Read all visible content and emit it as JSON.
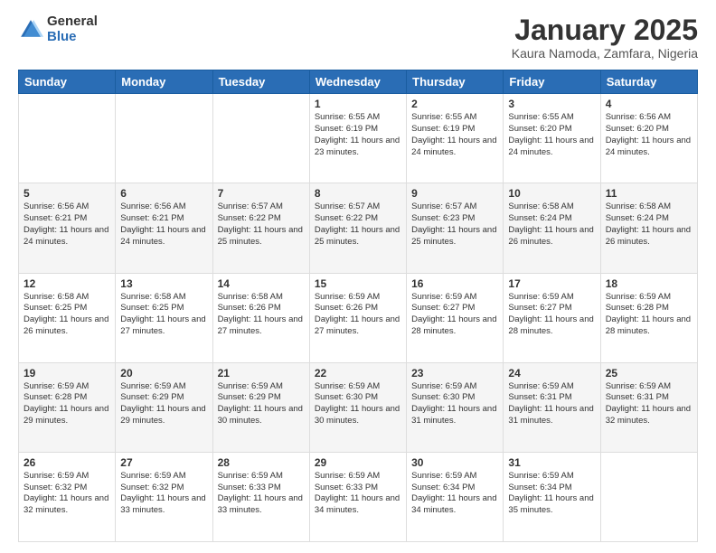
{
  "header": {
    "logo_general": "General",
    "logo_blue": "Blue",
    "month_title": "January 2025",
    "location": "Kaura Namoda, Zamfara, Nigeria"
  },
  "weekdays": [
    "Sunday",
    "Monday",
    "Tuesday",
    "Wednesday",
    "Thursday",
    "Friday",
    "Saturday"
  ],
  "weeks": [
    [
      {
        "day": "",
        "info": ""
      },
      {
        "day": "",
        "info": ""
      },
      {
        "day": "",
        "info": ""
      },
      {
        "day": "1",
        "info": "Sunrise: 6:55 AM\nSunset: 6:19 PM\nDaylight: 11 hours\nand 23 minutes."
      },
      {
        "day": "2",
        "info": "Sunrise: 6:55 AM\nSunset: 6:19 PM\nDaylight: 11 hours\nand 24 minutes."
      },
      {
        "day": "3",
        "info": "Sunrise: 6:55 AM\nSunset: 6:20 PM\nDaylight: 11 hours\nand 24 minutes."
      },
      {
        "day": "4",
        "info": "Sunrise: 6:56 AM\nSunset: 6:20 PM\nDaylight: 11 hours\nand 24 minutes."
      }
    ],
    [
      {
        "day": "5",
        "info": "Sunrise: 6:56 AM\nSunset: 6:21 PM\nDaylight: 11 hours\nand 24 minutes."
      },
      {
        "day": "6",
        "info": "Sunrise: 6:56 AM\nSunset: 6:21 PM\nDaylight: 11 hours\nand 24 minutes."
      },
      {
        "day": "7",
        "info": "Sunrise: 6:57 AM\nSunset: 6:22 PM\nDaylight: 11 hours\nand 25 minutes."
      },
      {
        "day": "8",
        "info": "Sunrise: 6:57 AM\nSunset: 6:22 PM\nDaylight: 11 hours\nand 25 minutes."
      },
      {
        "day": "9",
        "info": "Sunrise: 6:57 AM\nSunset: 6:23 PM\nDaylight: 11 hours\nand 25 minutes."
      },
      {
        "day": "10",
        "info": "Sunrise: 6:58 AM\nSunset: 6:24 PM\nDaylight: 11 hours\nand 26 minutes."
      },
      {
        "day": "11",
        "info": "Sunrise: 6:58 AM\nSunset: 6:24 PM\nDaylight: 11 hours\nand 26 minutes."
      }
    ],
    [
      {
        "day": "12",
        "info": "Sunrise: 6:58 AM\nSunset: 6:25 PM\nDaylight: 11 hours\nand 26 minutes."
      },
      {
        "day": "13",
        "info": "Sunrise: 6:58 AM\nSunset: 6:25 PM\nDaylight: 11 hours\nand 27 minutes."
      },
      {
        "day": "14",
        "info": "Sunrise: 6:58 AM\nSunset: 6:26 PM\nDaylight: 11 hours\nand 27 minutes."
      },
      {
        "day": "15",
        "info": "Sunrise: 6:59 AM\nSunset: 6:26 PM\nDaylight: 11 hours\nand 27 minutes."
      },
      {
        "day": "16",
        "info": "Sunrise: 6:59 AM\nSunset: 6:27 PM\nDaylight: 11 hours\nand 28 minutes."
      },
      {
        "day": "17",
        "info": "Sunrise: 6:59 AM\nSunset: 6:27 PM\nDaylight: 11 hours\nand 28 minutes."
      },
      {
        "day": "18",
        "info": "Sunrise: 6:59 AM\nSunset: 6:28 PM\nDaylight: 11 hours\nand 28 minutes."
      }
    ],
    [
      {
        "day": "19",
        "info": "Sunrise: 6:59 AM\nSunset: 6:28 PM\nDaylight: 11 hours\nand 29 minutes."
      },
      {
        "day": "20",
        "info": "Sunrise: 6:59 AM\nSunset: 6:29 PM\nDaylight: 11 hours\nand 29 minutes."
      },
      {
        "day": "21",
        "info": "Sunrise: 6:59 AM\nSunset: 6:29 PM\nDaylight: 11 hours\nand 30 minutes."
      },
      {
        "day": "22",
        "info": "Sunrise: 6:59 AM\nSunset: 6:30 PM\nDaylight: 11 hours\nand 30 minutes."
      },
      {
        "day": "23",
        "info": "Sunrise: 6:59 AM\nSunset: 6:30 PM\nDaylight: 11 hours\nand 31 minutes."
      },
      {
        "day": "24",
        "info": "Sunrise: 6:59 AM\nSunset: 6:31 PM\nDaylight: 11 hours\nand 31 minutes."
      },
      {
        "day": "25",
        "info": "Sunrise: 6:59 AM\nSunset: 6:31 PM\nDaylight: 11 hours\nand 32 minutes."
      }
    ],
    [
      {
        "day": "26",
        "info": "Sunrise: 6:59 AM\nSunset: 6:32 PM\nDaylight: 11 hours\nand 32 minutes."
      },
      {
        "day": "27",
        "info": "Sunrise: 6:59 AM\nSunset: 6:32 PM\nDaylight: 11 hours\nand 33 minutes."
      },
      {
        "day": "28",
        "info": "Sunrise: 6:59 AM\nSunset: 6:33 PM\nDaylight: 11 hours\nand 33 minutes."
      },
      {
        "day": "29",
        "info": "Sunrise: 6:59 AM\nSunset: 6:33 PM\nDaylight: 11 hours\nand 34 minutes."
      },
      {
        "day": "30",
        "info": "Sunrise: 6:59 AM\nSunset: 6:34 PM\nDaylight: 11 hours\nand 34 minutes."
      },
      {
        "day": "31",
        "info": "Sunrise: 6:59 AM\nSunset: 6:34 PM\nDaylight: 11 hours\nand 35 minutes."
      },
      {
        "day": "",
        "info": ""
      }
    ]
  ]
}
